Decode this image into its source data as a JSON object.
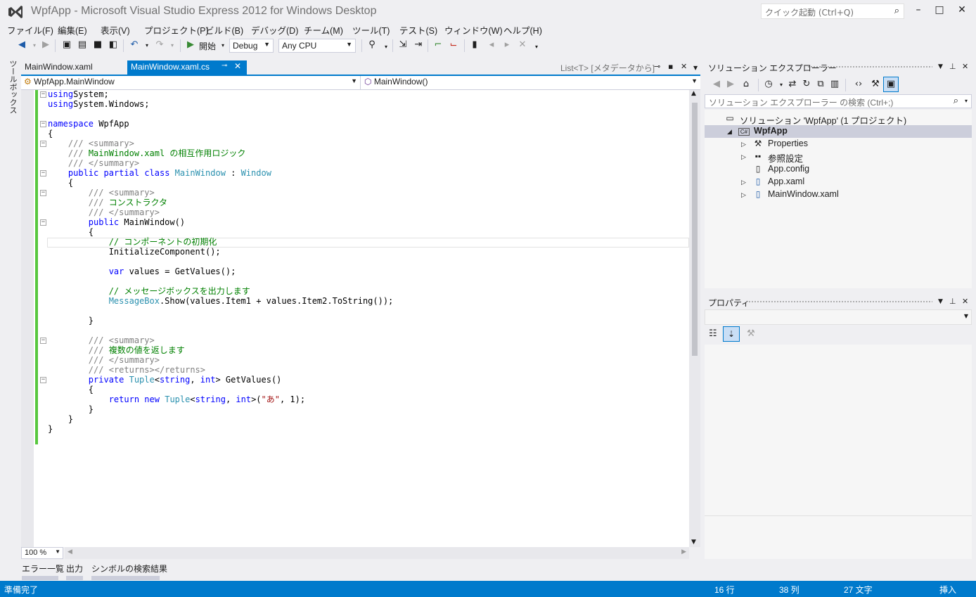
{
  "title": "WpfApp - Microsoft Visual Studio Express 2012 for Windows Desktop",
  "quick_launch_placeholder": "クイック起動 (Ctrl+Q)",
  "menu": [
    "ファイル(F)",
    "編集(E)",
    "表示(V)",
    "プロジェクト(P)",
    "ビルド(B)",
    "デバッグ(D)",
    "チーム(M)",
    "ツール(T)",
    "テスト(S)",
    "ウィンドウ(W)",
    "ヘルプ(H)"
  ],
  "toolbar": {
    "start_label": "開始",
    "config": "Debug",
    "platform": "Any CPU"
  },
  "toolbox_label": "ツールボックス",
  "editor": {
    "tabs": [
      {
        "label": "MainWindow.xaml",
        "active": false
      },
      {
        "label": "MainWindow.xaml.cs",
        "active": true
      }
    ],
    "list_tab": "List<T> [メタデータから]",
    "nav_type": "WpfApp.MainWindow",
    "nav_member": "MainWindow()",
    "zoom": "100 %",
    "code": [
      [
        [
          "k",
          "using"
        ],
        [
          "",
          "System;"
        ]
      ],
      [
        [
          "k",
          "using"
        ],
        [
          "",
          "System.Windows;"
        ]
      ],
      [],
      [
        [
          "k",
          "namespace"
        ],
        [
          "",
          " WpfApp"
        ]
      ],
      [
        [
          "",
          "{"
        ]
      ],
      [
        [
          "",
          "    "
        ],
        [
          "g",
          "///"
        ],
        [
          "c",
          " "
        ],
        [
          "g",
          "<summary>"
        ]
      ],
      [
        [
          "",
          "    "
        ],
        [
          "g",
          "///"
        ],
        [
          "c",
          " MainWindow.xaml の相互作用ロジック"
        ]
      ],
      [
        [
          "",
          "    "
        ],
        [
          "g",
          "///"
        ],
        [
          "c",
          " "
        ],
        [
          "g",
          "</summary>"
        ]
      ],
      [
        [
          "",
          "    "
        ],
        [
          "k",
          "public"
        ],
        [
          "",
          " "
        ],
        [
          "k",
          "partial"
        ],
        [
          "",
          " "
        ],
        [
          "k",
          "class"
        ],
        [
          "",
          " "
        ],
        [
          "t",
          "MainWindow"
        ],
        [
          "",
          " : "
        ],
        [
          "t",
          "Window"
        ]
      ],
      [
        [
          "",
          "    {"
        ]
      ],
      [
        [
          "",
          "        "
        ],
        [
          "g",
          "///"
        ],
        [
          "c",
          " "
        ],
        [
          "g",
          "<summary>"
        ]
      ],
      [
        [
          "",
          "        "
        ],
        [
          "g",
          "///"
        ],
        [
          "c",
          " コンストラクタ"
        ]
      ],
      [
        [
          "",
          "        "
        ],
        [
          "g",
          "///"
        ],
        [
          "c",
          " "
        ],
        [
          "g",
          "</summary>"
        ]
      ],
      [
        [
          "",
          "        "
        ],
        [
          "k",
          "public"
        ],
        [
          "",
          " MainWindow()"
        ]
      ],
      [
        [
          "",
          "        {"
        ]
      ],
      [
        [
          "",
          "            "
        ],
        [
          "c",
          "// コンポーネントの初期化"
        ]
      ],
      [
        [
          "",
          "            InitializeComponent();"
        ]
      ],
      [],
      [
        [
          "",
          "            "
        ],
        [
          "k",
          "var"
        ],
        [
          "",
          " values = GetValues();"
        ]
      ],
      [],
      [
        [
          "",
          "            "
        ],
        [
          "c",
          "// メッセージボックスを出力します"
        ]
      ],
      [
        [
          "",
          "            "
        ],
        [
          "t",
          "MessageBox"
        ],
        [
          "",
          ".Show(values.Item1 + values.Item2.ToString());"
        ]
      ],
      [],
      [
        [
          "",
          "        }"
        ]
      ],
      [],
      [
        [
          "",
          "        "
        ],
        [
          "g",
          "///"
        ],
        [
          "c",
          " "
        ],
        [
          "g",
          "<summary>"
        ]
      ],
      [
        [
          "",
          "        "
        ],
        [
          "g",
          "///"
        ],
        [
          "c",
          " 複数の値を返します"
        ]
      ],
      [
        [
          "",
          "        "
        ],
        [
          "g",
          "///"
        ],
        [
          "c",
          " "
        ],
        [
          "g",
          "</summary>"
        ]
      ],
      [
        [
          "",
          "        "
        ],
        [
          "g",
          "///"
        ],
        [
          "c",
          " "
        ],
        [
          "g",
          "<returns></returns>"
        ]
      ],
      [
        [
          "",
          "        "
        ],
        [
          "k",
          "private"
        ],
        [
          "",
          " "
        ],
        [
          "t",
          "Tuple"
        ],
        [
          "",
          "<"
        ],
        [
          "k",
          "string"
        ],
        [
          "",
          ", "
        ],
        [
          "k",
          "int"
        ],
        [
          "",
          "> GetValues()"
        ]
      ],
      [
        [
          "",
          "        {"
        ]
      ],
      [
        [
          "",
          "            "
        ],
        [
          "k",
          "return"
        ],
        [
          "",
          " "
        ],
        [
          "k",
          "new"
        ],
        [
          "",
          " "
        ],
        [
          "t",
          "Tuple"
        ],
        [
          "",
          "<"
        ],
        [
          "k",
          "string"
        ],
        [
          "",
          ", "
        ],
        [
          "k",
          "int"
        ],
        [
          "",
          ">("
        ],
        [
          "s",
          "\"あ\""
        ],
        [
          "",
          ", 1);"
        ]
      ],
      [
        [
          "",
          "        }"
        ]
      ],
      [
        [
          "",
          "    }"
        ]
      ],
      [
        [
          "",
          "}"
        ]
      ]
    ],
    "fold_lines": [
      0,
      3,
      5,
      8,
      10,
      13,
      25,
      29
    ]
  },
  "bottom_tabs": [
    "エラー一覧",
    "出力",
    "シンボルの検索結果"
  ],
  "status": {
    "message": "準備完了",
    "line": "16 行",
    "col": "38 列",
    "ch": "27 文字",
    "mode": "挿入"
  },
  "solution_explorer": {
    "title": "ソリューション エクスプローラー",
    "search_placeholder": "ソリューション エクスプローラー の検索 (Ctrl+;)",
    "tree": [
      {
        "label": "ソリューション 'WpfApp' (1 プロジェクト)",
        "icon": "solution-icon",
        "level": 0,
        "expander": "",
        "bold": false,
        "selected": false
      },
      {
        "label": "WpfApp",
        "icon": "csharp-project-icon",
        "level": 1,
        "expander": "expanded",
        "bold": true,
        "selected": true
      },
      {
        "label": "Properties",
        "icon": "wrench-icon",
        "level": 2,
        "expander": "collapsed",
        "bold": false,
        "selected": false
      },
      {
        "label": "参照設定",
        "icon": "references-icon",
        "level": 2,
        "expander": "collapsed",
        "bold": false,
        "selected": false
      },
      {
        "label": "App.config",
        "icon": "config-file-icon",
        "level": 2,
        "expander": "",
        "bold": false,
        "selected": false
      },
      {
        "label": "App.xaml",
        "icon": "xaml-file-icon",
        "level": 2,
        "expander": "collapsed",
        "bold": false,
        "selected": false
      },
      {
        "label": "MainWindow.xaml",
        "icon": "xaml-file-icon",
        "level": 2,
        "expander": "collapsed",
        "bold": false,
        "selected": false
      }
    ]
  },
  "properties": {
    "title": "プロパティ"
  }
}
